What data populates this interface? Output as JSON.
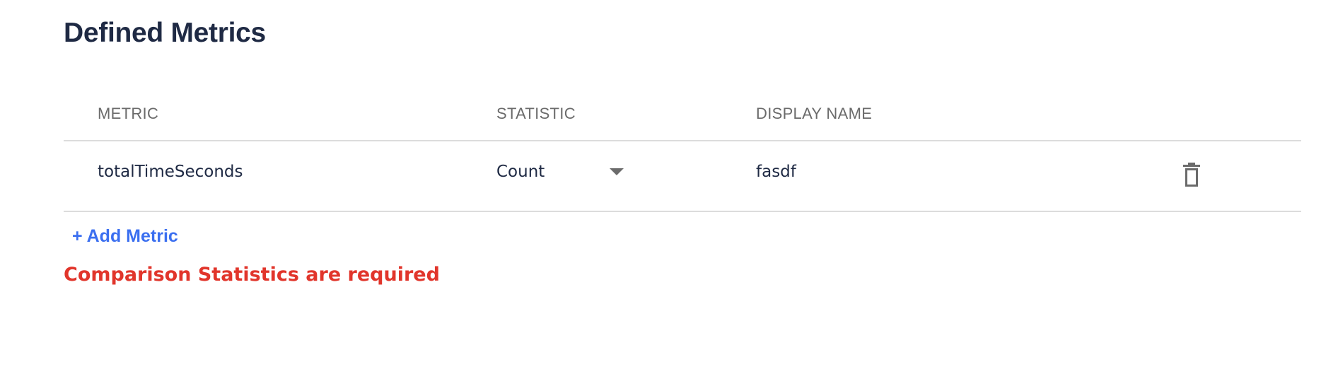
{
  "section": {
    "title": "Defined Metrics"
  },
  "table": {
    "columns": [
      "METRIC",
      "STATISTIC",
      "DISPLAY NAME"
    ],
    "rows": [
      {
        "metric": "totalTimeSeconds",
        "statistic": "Count",
        "display_name": "fasdf",
        "delete_icon": "trash-icon"
      }
    ]
  },
  "actions": {
    "add_metric_label": "+ Add Metric"
  },
  "validation": {
    "error_message": "Comparison Statistics are required"
  },
  "colors": {
    "title": "#1f2a44",
    "header_text": "#6b6b6b",
    "divider": "#dcdcdc",
    "link": "#3b6ff0",
    "error": "#e1352b"
  }
}
